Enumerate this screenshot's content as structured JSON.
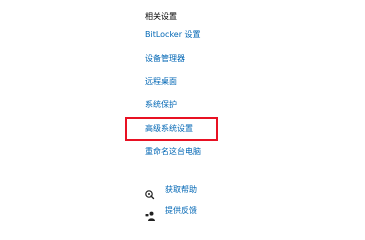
{
  "related_settings": {
    "heading": "相关设置",
    "links": [
      "BitLocker 设置",
      "设备管理器",
      "远程桌面",
      "系统保护",
      "高级系统设置",
      "重命名这台电脑"
    ],
    "highlight_color": "#e81123",
    "link_color": "#0066b4"
  },
  "help": {
    "items": [
      {
        "label": "获取帮助",
        "icon": "help-chat-icon"
      },
      {
        "label": "提供反馈",
        "icon": "feedback-person-icon"
      }
    ]
  }
}
